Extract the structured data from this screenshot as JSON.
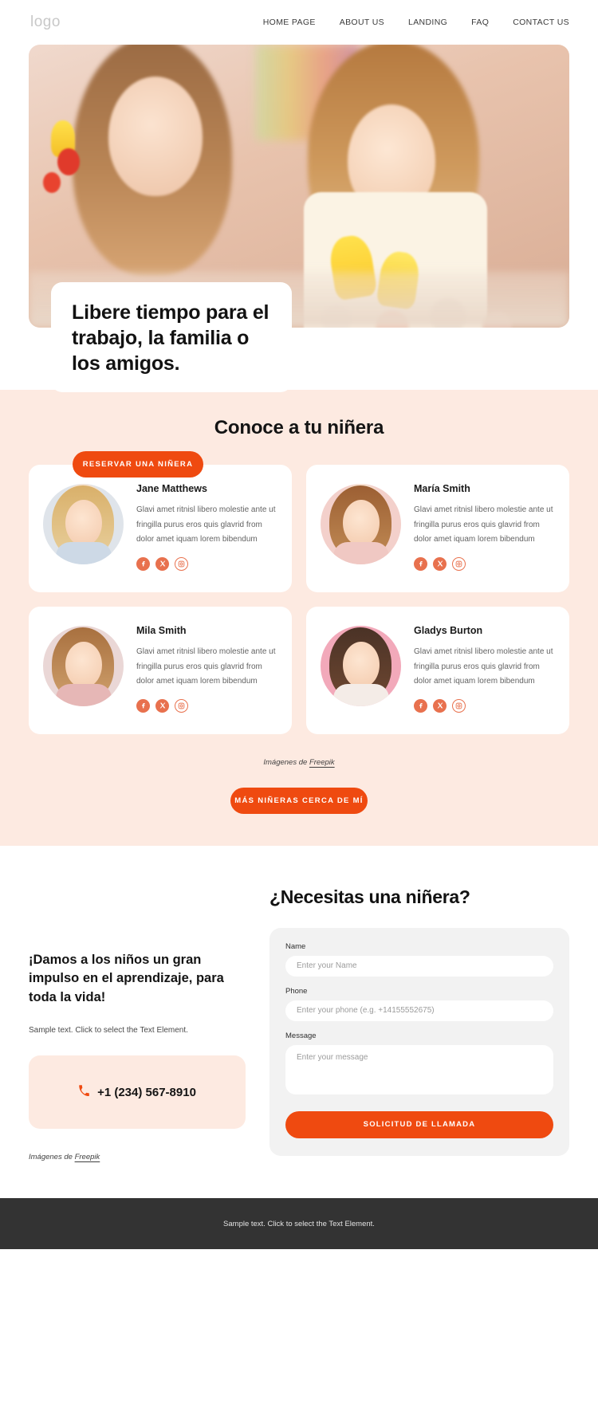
{
  "header": {
    "logo": "logo",
    "nav": [
      {
        "label": "HOME PAGE"
      },
      {
        "label": "ABOUT US"
      },
      {
        "label": "LANDING"
      },
      {
        "label": "FAQ"
      },
      {
        "label": "CONTACT US"
      }
    ]
  },
  "hero": {
    "title": "Libere tiempo para el trabajo, la familia o los amigos.",
    "cta_label": "RESERVAR UNA NIÑERA"
  },
  "nannies": {
    "title": "Conoce a tu niñera",
    "credit_prefix": "Imágenes de ",
    "credit_link": "Freepik",
    "more_label": "MÁS NIÑERAS CERCA DE MÍ",
    "cards": [
      {
        "name": "Jane Matthews",
        "desc": "Glavi amet ritnisl libero molestie ante ut fringilla purus eros quis glavrid from dolor amet iquam lorem bibendum"
      },
      {
        "name": "María Smith",
        "desc": "Glavi amet ritnisl libero molestie ante ut fringilla purus eros quis glavrid from dolor amet iquam lorem bibendum"
      },
      {
        "name": "Mila Smith",
        "desc": "Glavi amet ritnisl libero molestie ante ut fringilla purus eros quis glavrid from dolor amet iquam lorem bibendum"
      },
      {
        "name": "Gladys Burton",
        "desc": "Glavi amet ritnisl libero molestie ante ut fringilla purus eros quis glavrid from dolor amet iquam lorem bibendum"
      }
    ],
    "socials": [
      {
        "name": "facebook-icon"
      },
      {
        "name": "x-twitter-icon"
      },
      {
        "name": "instagram-icon"
      }
    ]
  },
  "contact": {
    "heading": "¡Damos a los niños un gran impulso en el aprendizaje, para toda la vida!",
    "subtext": "Sample text. Click to select the Text Element.",
    "phone": "+1 (234) 567-8910",
    "credit_prefix": "Imágenes de ",
    "credit_link": "Freepik",
    "form": {
      "title": "¿Necesitas una niñera?",
      "name_label": "Name",
      "name_placeholder": "Enter your Name",
      "phone_label": "Phone",
      "phone_placeholder": "Enter your phone (e.g. +14155552675)",
      "message_label": "Message",
      "message_placeholder": "Enter your message",
      "submit_label": "SOLICITUD DE LLAMADA"
    }
  },
  "footer": {
    "text": "Sample text. Click to select the Text Element."
  },
  "colors": {
    "accent": "#ef4a10",
    "social": "#e8714e",
    "section_bg": "#fdeae1",
    "footer_bg": "#333333"
  }
}
